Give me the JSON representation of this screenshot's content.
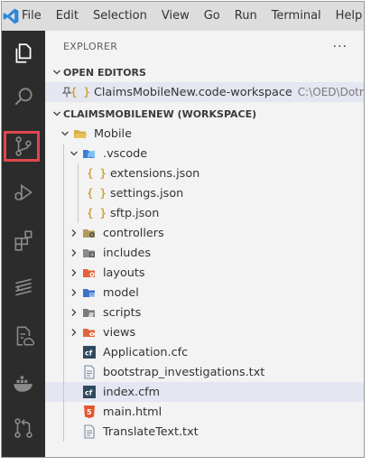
{
  "menu": [
    "File",
    "Edit",
    "Selection",
    "View",
    "Go",
    "Run",
    "Terminal",
    "Help"
  ],
  "explorer": {
    "title": "EXPLORER",
    "more": "···",
    "open_editors": {
      "label": "OPEN EDITORS",
      "items": [
        {
          "name": "ClaimsMobileNew.code-workspace",
          "path": "C:\\OED\\Dotne..."
        }
      ]
    },
    "workspace": {
      "label": "CLAIMSMOBILENEW (WORKSPACE)",
      "tree": {
        "mobile": "Mobile",
        "vscode": ".vscode",
        "vscode_children": [
          "extensions.json",
          "settings.json",
          "sftp.json"
        ],
        "folders": [
          "controllers",
          "includes",
          "layouts",
          "model",
          "scripts",
          "views"
        ],
        "files": [
          "Application.cfc",
          "bootstrap_investigations.txt",
          "index.cfm",
          "main.html",
          "TranslateText.txt"
        ]
      }
    }
  },
  "colors": {
    "activity_bg": "#2c2c2c",
    "menubar_bg": "#dddddd",
    "sidebar_bg": "#f3f3f3",
    "selection": "#e4e6f1",
    "highlight_box": "#e0474c",
    "vscode_blue": "#2b88d8"
  }
}
